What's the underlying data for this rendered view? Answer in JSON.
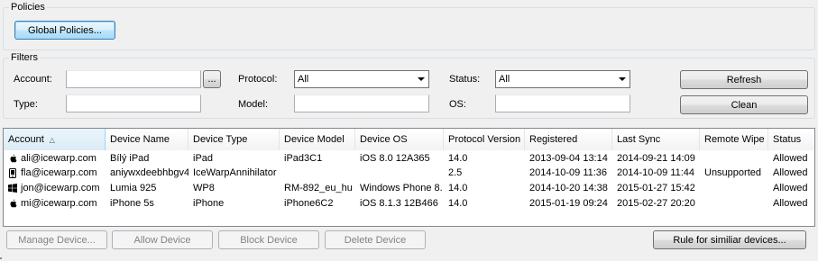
{
  "policies": {
    "title": "Policies",
    "global_button": "Global Policies..."
  },
  "filters": {
    "title": "Filters",
    "account_label": "Account:",
    "account_value": "",
    "browse_button": "...",
    "type_label": "Type:",
    "type_value": "",
    "protocol_label": "Protocol:",
    "protocol_value": "All",
    "model_label": "Model:",
    "model_value": "",
    "status_label": "Status:",
    "status_value": "All",
    "os_label": "OS:",
    "os_value": "",
    "refresh_button": "Refresh",
    "clean_button": "Clean"
  },
  "table": {
    "columns": [
      "Account",
      "Device Name",
      "Device Type",
      "Device Model",
      "Device OS",
      "Protocol Version",
      "Registered",
      "Last Sync",
      "Remote Wipe",
      "Status"
    ],
    "rows": [
      {
        "icon": "apple-icon",
        "account": "ali@icewarp.com",
        "device_name": "Bílý iPad",
        "device_type": "iPad",
        "device_model": "iPad3C1",
        "device_os": "iOS 8.0 12A365",
        "protocol_version": "14.0",
        "registered": "2013-09-04 13:14",
        "last_sync": "2014-09-21 14:09",
        "remote_wipe": "",
        "status": "Allowed"
      },
      {
        "icon": "phone-icon",
        "account": "fla@icewarp.com",
        "device_name": "aniywxdeebhbgv4",
        "device_type": "IceWarpAnnihilator",
        "device_model": "",
        "device_os": "",
        "protocol_version": "2.5",
        "registered": "2014-10-09 11:36",
        "last_sync": "2014-10-09 11:44",
        "remote_wipe": "Unsupported",
        "status": "Allowed"
      },
      {
        "icon": "windows-icon",
        "account": "jon@icewarp.com",
        "device_name": "Lumia 925",
        "device_type": "WP8",
        "device_model": "RM-892_eu_hu",
        "device_os": "Windows Phone 8.",
        "protocol_version": "14.0",
        "registered": "2014-10-20 14:38",
        "last_sync": "2015-01-27 15:42",
        "remote_wipe": "",
        "status": "Allowed"
      },
      {
        "icon": "apple-icon",
        "account": "mi@icewarp.com",
        "device_name": "iPhone 5s",
        "device_type": "iPhone",
        "device_model": "iPhone6C2",
        "device_os": "iOS 8.1.3 12B466",
        "protocol_version": "14.0",
        "registered": "2015-01-19 09:24",
        "last_sync": "2015-02-27 20:20",
        "remote_wipe": "",
        "status": "Allowed"
      }
    ]
  },
  "actions": {
    "manage": "Manage Device...",
    "allow": "Allow Device",
    "block": "Block Device",
    "delete": "Delete Device",
    "rule": "Rule for similiar devices..."
  }
}
